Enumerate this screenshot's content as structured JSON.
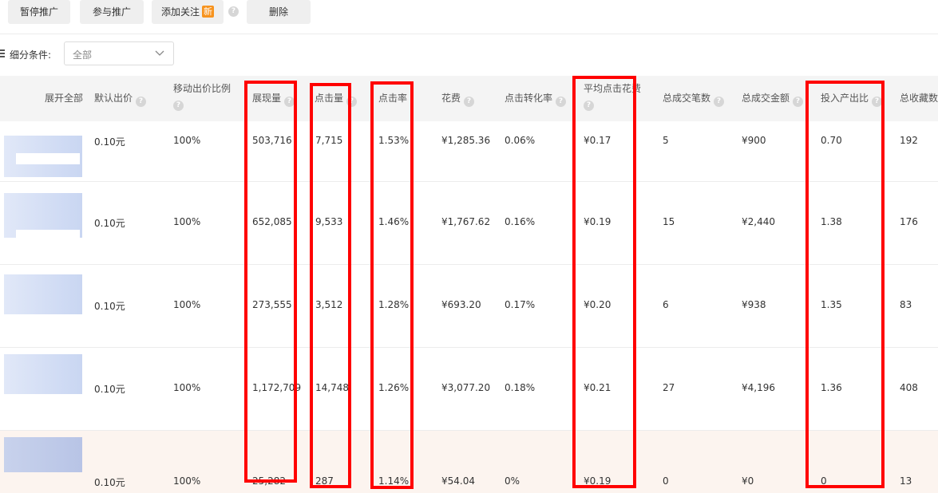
{
  "toolbar": {
    "pause_label": "暂停推广",
    "join_label": "参与推广",
    "follow_label": "添加关注",
    "new_badge": "新",
    "help_glyph": "?",
    "delete_label": "删除"
  },
  "filter": {
    "label": "细分条件:",
    "value": "全部"
  },
  "table": {
    "headers": {
      "expand": "展开全部",
      "default_bid": "默认出价",
      "mobile_ratio": "移动出价比例",
      "impressions": "展现量",
      "clicks": "点击量",
      "ctr": "点击率",
      "cost": "花费",
      "cvr": "点击转化率",
      "avg_cpc": "平均点击花费",
      "orders": "总成交笔数",
      "gmv": "总成交金额",
      "roi": "投入产出比",
      "favorites": "总收藏数"
    },
    "rows": [
      {
        "default_bid": "0.10元",
        "mobile_ratio": "100%",
        "impressions": "503,716",
        "clicks": "7,715",
        "ctr": "1.53%",
        "cost": "¥1,285.36",
        "cvr": "0.06%",
        "avg_cpc": "¥0.17",
        "orders": "5",
        "gmv": "¥900",
        "roi": "0.70",
        "favorites": "192"
      },
      {
        "default_bid": "0.10元",
        "mobile_ratio": "100%",
        "impressions": "652,085",
        "clicks": "9,533",
        "ctr": "1.46%",
        "cost": "¥1,767.62",
        "cvr": "0.16%",
        "avg_cpc": "¥0.19",
        "orders": "15",
        "gmv": "¥2,440",
        "roi": "1.38",
        "favorites": "176"
      },
      {
        "default_bid": "0.10元",
        "mobile_ratio": "100%",
        "impressions": "273,555",
        "clicks": "3,512",
        "ctr": "1.28%",
        "cost": "¥693.20",
        "cvr": "0.17%",
        "avg_cpc": "¥0.20",
        "orders": "6",
        "gmv": "¥938",
        "roi": "1.35",
        "favorites": "83"
      },
      {
        "default_bid": "0.10元",
        "mobile_ratio": "100%",
        "impressions": "1,172,709",
        "clicks": "14,748",
        "ctr": "1.26%",
        "cost": "¥3,077.20",
        "cvr": "0.18%",
        "avg_cpc": "¥0.21",
        "orders": "27",
        "gmv": "¥4,196",
        "roi": "1.36",
        "favorites": "408"
      },
      {
        "default_bid": "0.10元",
        "mobile_ratio": "100%",
        "impressions": "25,282",
        "clicks": "287",
        "ctr": "1.14%",
        "cost": "¥54.04",
        "cvr": "0%",
        "avg_cpc": "¥0.19",
        "orders": "0",
        "gmv": "¥0",
        "roi": "0",
        "favorites": "13"
      }
    ]
  },
  "colors": {
    "highlight_box": "#ff0000",
    "new_badge": "#f7931e",
    "header_bg": "#f4f4f4",
    "last_row_bg": "#fcf4ef"
  },
  "icons": [
    "help-icon",
    "chevron-down-icon",
    "filter-icon",
    "item-thumbnail"
  ]
}
